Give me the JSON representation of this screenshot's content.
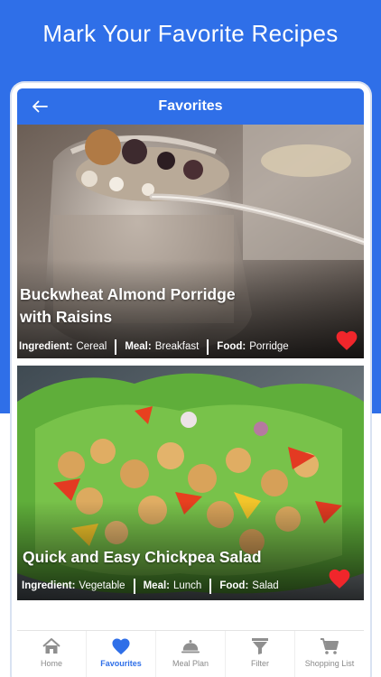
{
  "promo": {
    "title": "Mark Your Favorite Recipes",
    "background": "#2f6fe8"
  },
  "app_bar": {
    "title": "Favorites",
    "back_icon": "arrow-left-icon",
    "color": "#2f6fe8"
  },
  "recipes": [
    {
      "title_line1": "Buckwheat Almond Porridge",
      "title_line2": "with Raisins",
      "ingredient_label": "Ingredient:",
      "ingredient": "Cereal",
      "meal_label": "Meal:",
      "meal": "Breakfast",
      "food_label": "Food:",
      "food": "Porridge",
      "favorite": true,
      "favorite_icon": "heart-icon"
    },
    {
      "title_line1": "Quick and Easy Chickpea Salad",
      "ingredient_label": "Ingredient:",
      "ingredient": "Vegetable",
      "meal_label": "Meal:",
      "meal": "Lunch",
      "food_label": "Food:",
      "food": "Salad",
      "favorite": true,
      "favorite_icon": "heart-icon"
    }
  ],
  "favorite_color": "#f0262b",
  "tabs": [
    {
      "label": "Home",
      "icon": "home-icon",
      "active": false
    },
    {
      "label": "Favourites",
      "icon": "heart-icon",
      "active": true
    },
    {
      "label": "Meal Plan",
      "icon": "cloche-icon",
      "active": false
    },
    {
      "label": "Filter",
      "icon": "filter-icon",
      "active": false
    },
    {
      "label": "Shopping List",
      "icon": "cart-icon",
      "active": false
    }
  ]
}
